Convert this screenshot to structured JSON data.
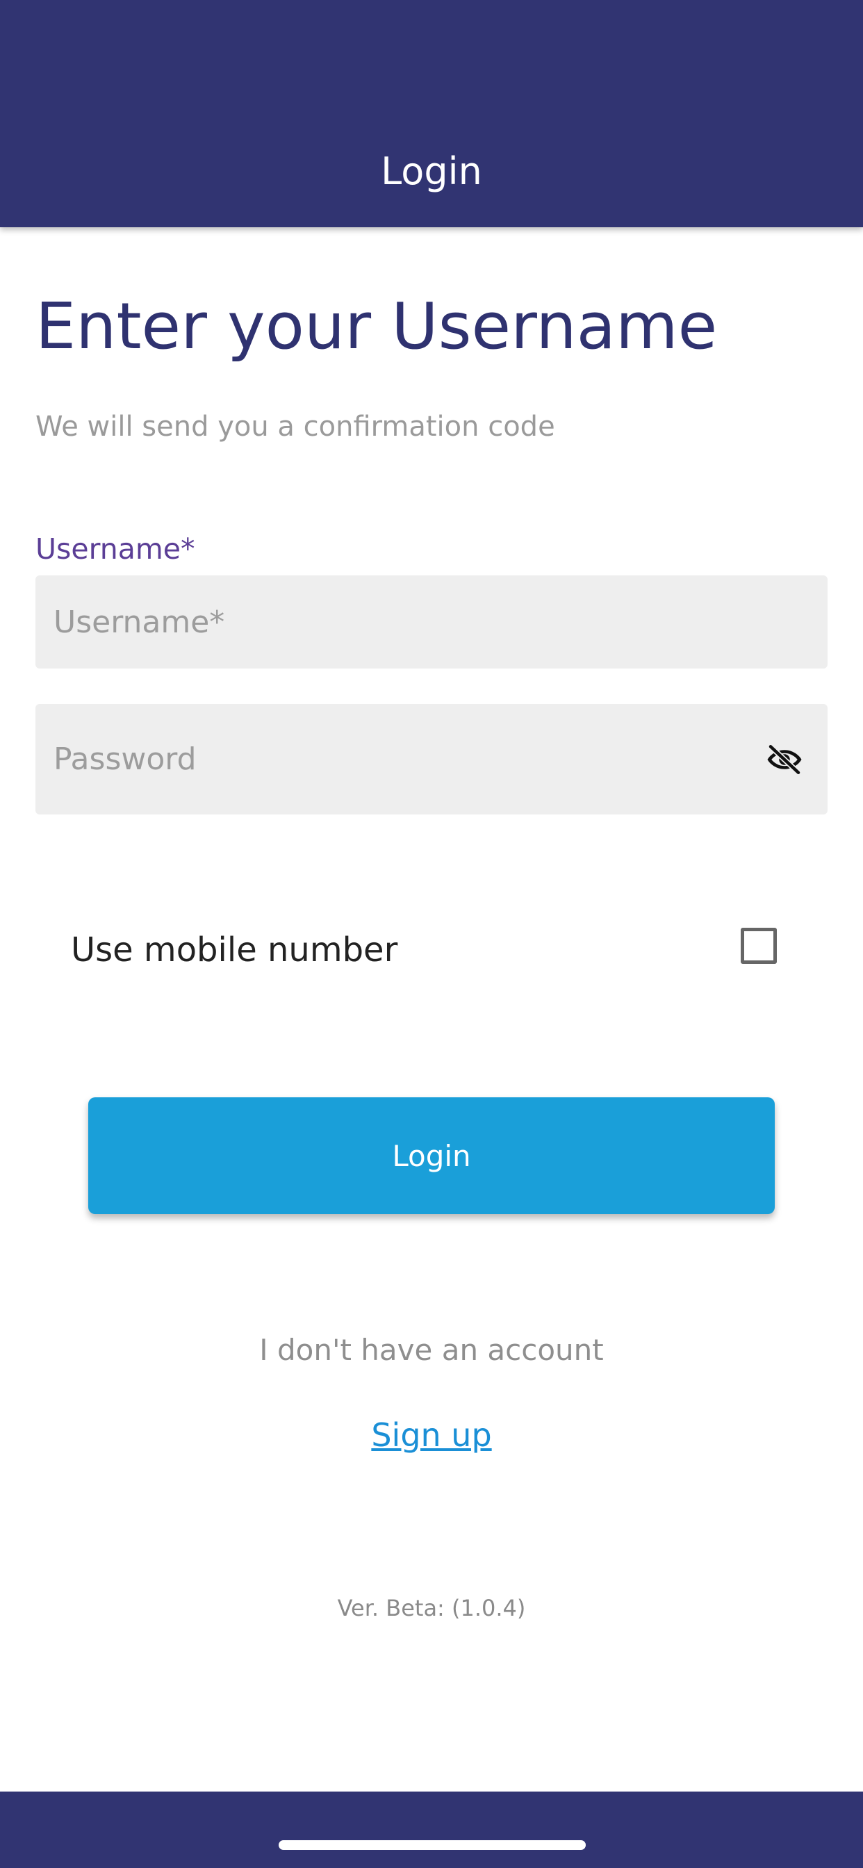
{
  "app_bar": {
    "title": "Login"
  },
  "form": {
    "heading": "Enter your Username",
    "subheading": "We will send you a confirmation code",
    "username_label": "Username*",
    "username_placeholder": "Username*",
    "password_placeholder": "Password",
    "password_toggle_icon": "eye-off-icon",
    "use_mobile_label": "Use mobile number",
    "use_mobile_checked": false,
    "login_button": "Login"
  },
  "footer": {
    "no_account_text": "I don't have an account",
    "signup_link": "Sign up",
    "version": "Ver. Beta: (1.0.4)"
  },
  "colors": {
    "app_bar": "#313472",
    "heading": "#2f3270",
    "label_accent": "#5b3e96",
    "primary_button": "#1a9fd9",
    "link": "#1a8fd6"
  }
}
